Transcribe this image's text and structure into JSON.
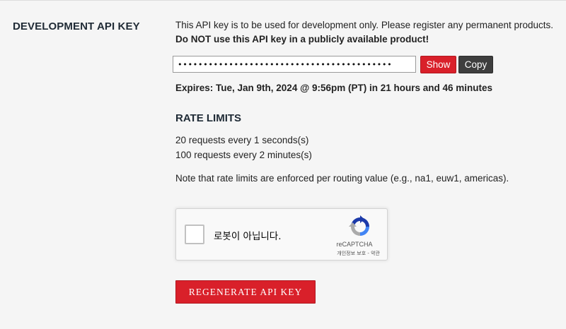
{
  "section": {
    "title": "DEVELOPMENT API KEY"
  },
  "intro": {
    "line1": "This API key is to be used for development only. Please register any permanent products.",
    "warning": "Do NOT use this API key in a publicly available product!"
  },
  "api_key": {
    "masked_value": "••••••••••••••••••••••••••••••••••••••••••",
    "show_label": "Show",
    "copy_label": "Copy"
  },
  "expires": {
    "text": "Expires: Tue, Jan 9th, 2024 @ 9:56pm (PT) in 21 hours and 46 minutes"
  },
  "rate_limits": {
    "title": "RATE LIMITS",
    "lines": [
      "20 requests every 1 seconds(s)",
      "100 requests every 2 minutes(s)"
    ],
    "note": "Note that rate limits are enforced per routing value (e.g., na1, euw1, americas)."
  },
  "captcha": {
    "label": "로봇이 아닙니다.",
    "brand": "reCAPTCHA",
    "links": "개인정보 보호 - 약관",
    "checked": false,
    "logo_icon": "recaptcha-logo-icon"
  },
  "regenerate": {
    "label": "REGENERATE API KEY"
  },
  "colors": {
    "background": "#f5f5f5",
    "primary_red": "#d9202a",
    "dark_button": "#3e3e3e",
    "heading": "#1f2a35"
  }
}
